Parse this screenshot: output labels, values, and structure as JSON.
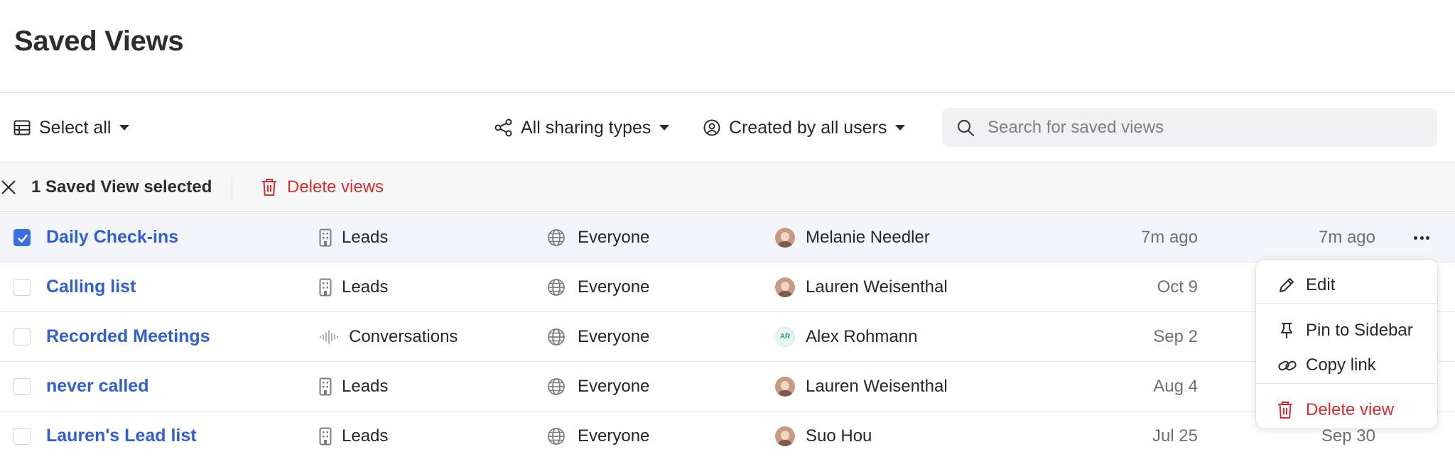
{
  "page": {
    "title": "Saved Views"
  },
  "toolbar": {
    "select_all": "Select all",
    "sharing_filter": "All sharing types",
    "creator_filter": "Created by all users",
    "search_placeholder": "Search for saved views"
  },
  "selection": {
    "count_label": "1 Saved View selected",
    "delete_label": "Delete views"
  },
  "rows": [
    {
      "name": "Daily Check-ins",
      "type": "Leads",
      "type_icon": "building-icon",
      "sharing": "Everyone",
      "owner": "Melanie Needler",
      "owner_avatar": "photo",
      "modified": "7m ago",
      "viewed": "7m ago",
      "selected": true
    },
    {
      "name": "Calling list",
      "type": "Leads",
      "type_icon": "building-icon",
      "sharing": "Everyone",
      "owner": "Lauren Weisenthal",
      "owner_avatar": "photo",
      "modified": "Oct 9",
      "viewed": "",
      "selected": false
    },
    {
      "name": "Recorded Meetings",
      "type": "Conversations",
      "type_icon": "waveform-icon",
      "sharing": "Everyone",
      "owner": "Alex Rohmann",
      "owner_avatar": "initials",
      "owner_initials": "AR",
      "modified": "Sep 2",
      "viewed": "",
      "selected": false
    },
    {
      "name": "never called",
      "type": "Leads",
      "type_icon": "building-icon",
      "sharing": "Everyone",
      "owner": "Lauren Weisenthal",
      "owner_avatar": "photo",
      "modified": "Aug 4",
      "viewed": "",
      "selected": false
    },
    {
      "name": "Lauren's Lead list",
      "type": "Leads",
      "type_icon": "building-icon",
      "sharing": "Everyone",
      "owner": "Suo Hou",
      "owner_avatar": "photo",
      "modified": "Jul 25",
      "viewed": "Sep 30",
      "selected": false
    }
  ],
  "context_menu": {
    "edit": "Edit",
    "pin": "Pin to Sidebar",
    "copy": "Copy link",
    "delete": "Delete view"
  },
  "colors": {
    "accent": "#2f5fd0",
    "checkbox": "#3a6fe3",
    "danger": "#d32f2f",
    "muted": "#6e7076"
  }
}
